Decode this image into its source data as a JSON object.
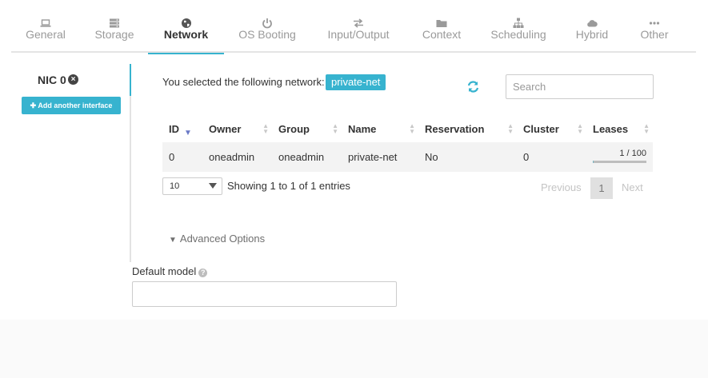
{
  "tabs": [
    {
      "label": "General",
      "icon": "laptop-icon",
      "active": false
    },
    {
      "label": "Storage",
      "icon": "storage-icon",
      "active": false
    },
    {
      "label": "Network",
      "icon": "globe-icon",
      "active": true
    },
    {
      "label": "OS Booting",
      "icon": "power-icon",
      "active": false
    },
    {
      "label": "Input/Output",
      "icon": "exchange-icon",
      "active": false
    },
    {
      "label": "Context",
      "icon": "folder-icon",
      "active": false
    },
    {
      "label": "Scheduling",
      "icon": "sitemap-icon",
      "active": false
    },
    {
      "label": "Hybrid",
      "icon": "cloud-icon",
      "active": false
    },
    {
      "label": "Other",
      "icon": "ellipsis-icon",
      "active": false
    }
  ],
  "nic": {
    "label": "NIC 0",
    "close_icon": "×",
    "add_interface_label": "✚ Add another interface"
  },
  "selection": {
    "text": "You selected the following network:",
    "network": "private-net"
  },
  "search": {
    "placeholder": "Search",
    "value": ""
  },
  "table": {
    "columns": [
      "ID",
      "Owner",
      "Group",
      "Name",
      "Reservation",
      "Cluster",
      "Leases"
    ],
    "rows": [
      {
        "id": "0",
        "owner": "oneadmin",
        "group": "oneadmin",
        "name": "private-net",
        "reservation": "No",
        "cluster": "0",
        "leases": "1 / 100",
        "leases_fraction": 0.01
      }
    ]
  },
  "pagination": {
    "page_length": "10",
    "showing": "Showing 1 to 1 of 1 entries",
    "previous": "Previous",
    "current": "1",
    "next": "Next"
  },
  "advanced": {
    "label": "Advanced Options"
  },
  "default_model": {
    "label": "Default model",
    "value": ""
  },
  "colors": {
    "accent": "#37b3cf",
    "sort_active": "#6a79c6"
  }
}
